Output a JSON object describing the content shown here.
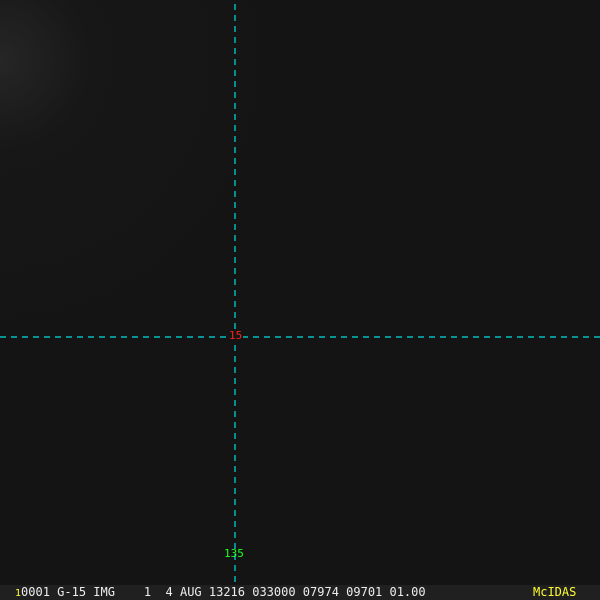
{
  "image": {
    "center_value": "15",
    "longitude_label": "135",
    "crosshair_color": "#00e0e0"
  },
  "status_bar": {
    "frame_number": "1",
    "info": "0001 G-15 IMG    1  4 AUG 13216 033000 07974 09701 01.00",
    "brand": "McIDAS"
  }
}
